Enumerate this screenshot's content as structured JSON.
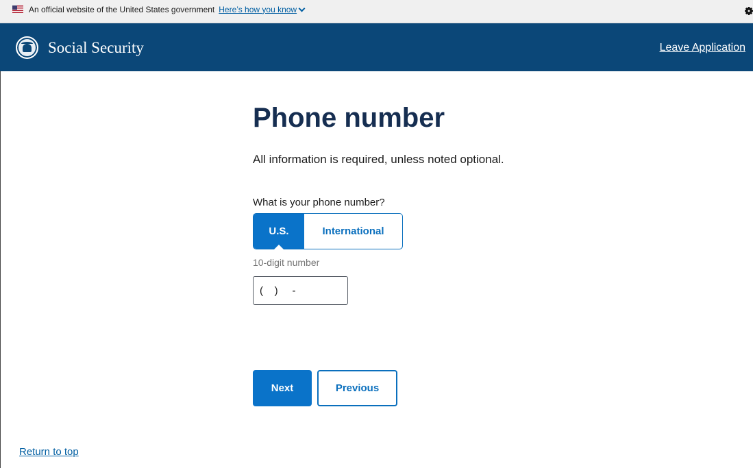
{
  "banner": {
    "text": "An official website of the United States government",
    "link": "Here’s how you know"
  },
  "header": {
    "title": "Social Security",
    "leave_link": "Leave Application"
  },
  "main": {
    "title": "Phone number",
    "intro": "All information is required, unless noted optional.",
    "question": "What is your phone number?",
    "toggle": {
      "options": [
        "U.S.",
        "International"
      ],
      "selected": "U.S."
    },
    "hint": "10-digit number",
    "phone_value": "(    )     -"
  },
  "buttons": {
    "next": "Next",
    "previous": "Previous"
  },
  "footer": {
    "return_top": "Return to top"
  },
  "colors": {
    "header_bg": "#0b4778",
    "primary": "#0a73c9",
    "title": "#162e51",
    "link": "#005ea2"
  }
}
